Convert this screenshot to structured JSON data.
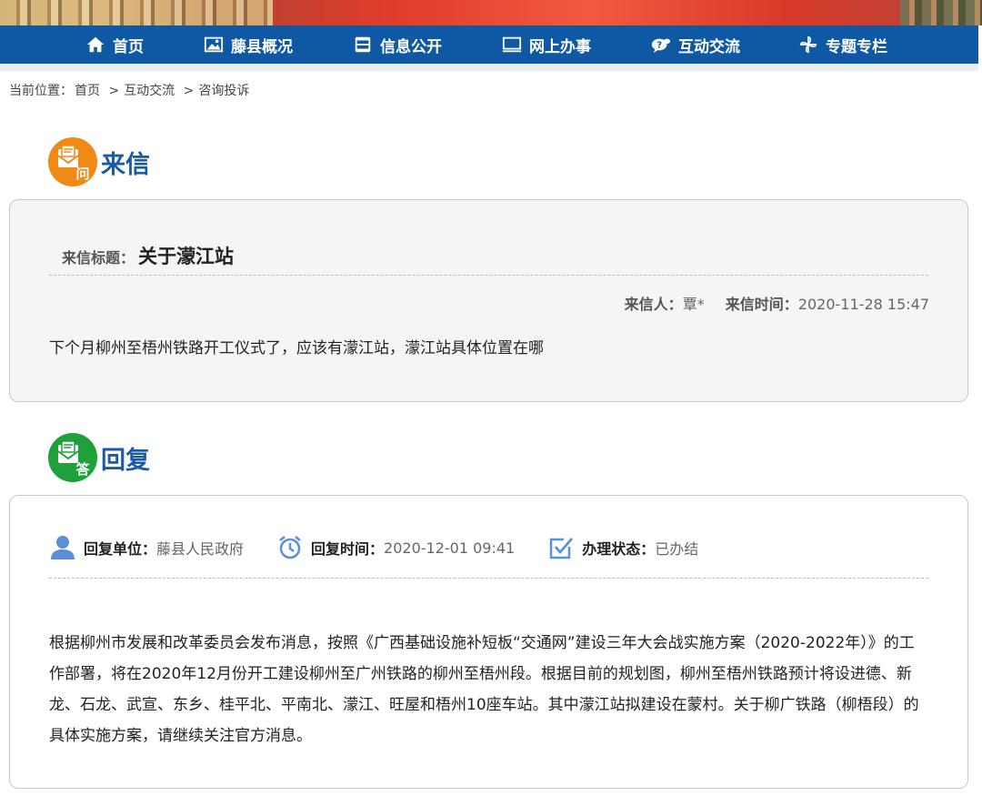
{
  "nav": {
    "items": [
      {
        "label": "首页",
        "icon": "home-icon"
      },
      {
        "label": "藤县概况",
        "icon": "picture-icon"
      },
      {
        "label": "信息公开",
        "icon": "cabinet-icon"
      },
      {
        "label": "网上办事",
        "icon": "monitor-icon"
      },
      {
        "label": "互动交流",
        "icon": "chat-icon"
      },
      {
        "label": "专题专栏",
        "icon": "pinwheel-icon"
      }
    ]
  },
  "breadcrumb": {
    "prefix": "当前位置：",
    "items": [
      "首页",
      "互动交流",
      "咨询投诉"
    ],
    "separator": ">"
  },
  "letter": {
    "section_title": "来信",
    "badge": "问",
    "title_label": "来信标题：",
    "title": "关于濛江站",
    "sender_label": "来信人：",
    "sender": "覃*",
    "time_label": "来信时间：",
    "time": "2020-11-28 15:47",
    "content": "下个月柳州至梧州铁路开工仪式了，应该有濛江站，濛江站具体位置在哪"
  },
  "reply": {
    "section_title": "回复",
    "badge": "答",
    "unit_label": "回复单位：",
    "unit": "藤县人民政府",
    "time_label": "回复时间：",
    "time": "2020-12-01 09:41",
    "status_label": "办理状态：",
    "status": "已办结",
    "content": "根据柳州市发展和改革委员会发布消息，按照《广西基础设施补短板“交通网”建设三年大会战实施方案（2020-2022年）》的工作部署，将在2020年12月份开工建设柳州至广州铁路的柳州至梧州段。根据目前的规划图，柳州至梧州铁路预计将设进德、新龙、石龙、武宣、东乡、桂平北、平南北、濛江、旺屋和梧州10座车站。其中濛江站拟建设在蒙村。关于柳广铁路（柳梧段）的具体实施方案，请继续关注官方消息。"
  },
  "colors": {
    "nav_bg": "#0e58a4",
    "section_title": "#1a5aa8",
    "letter_badge": "#f08a14",
    "reply_badge": "#1ea03a",
    "icon_blue": "#5b8fd6"
  }
}
